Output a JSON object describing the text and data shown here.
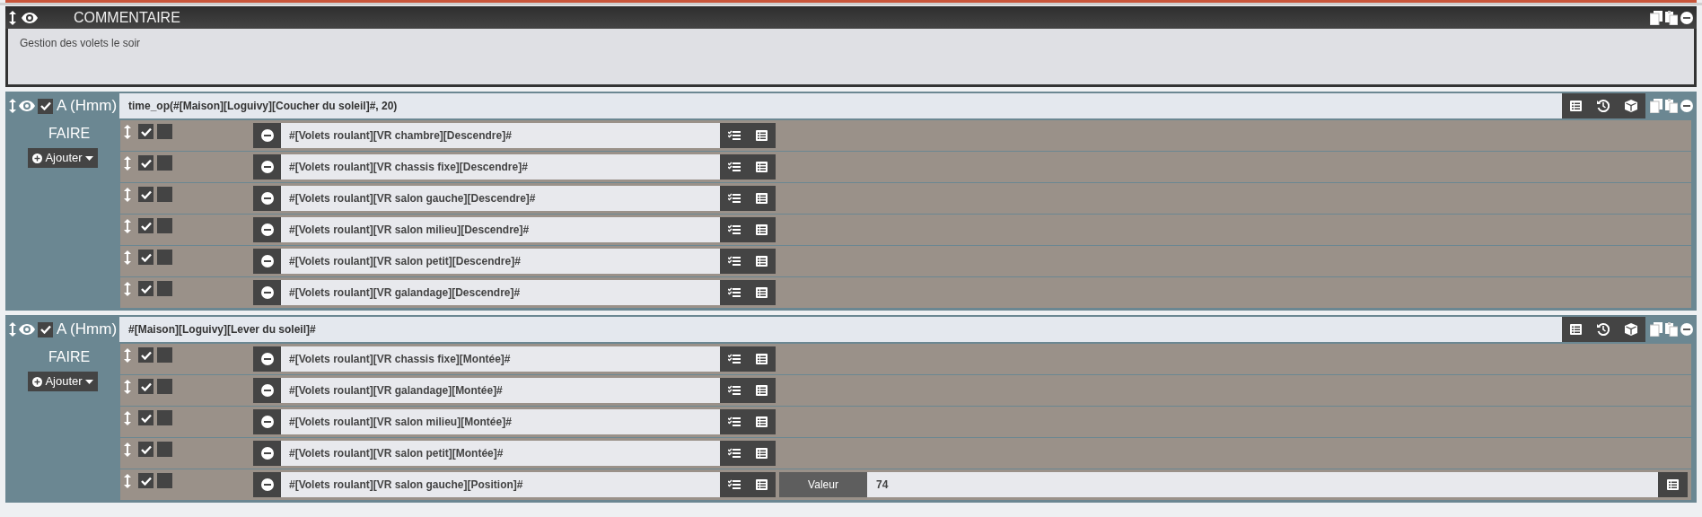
{
  "comment": {
    "title": "COMMENTAIRE",
    "text": "Gestion des volets le soir"
  },
  "blocks": [
    {
      "label": "A (Hmm)",
      "checked": true,
      "expression": "time_op(#[Maison][Loguivy][Coucher du soleil]#, 20)",
      "faire": "FAIRE",
      "add_button": "Ajouter",
      "actions": [
        {
          "checked": true,
          "flag": false,
          "command": "#[Volets roulant][VR chambre][Descendre]#"
        },
        {
          "checked": true,
          "flag": false,
          "command": "#[Volets roulant][VR chassis fixe][Descendre]#"
        },
        {
          "checked": true,
          "flag": false,
          "command": "#[Volets roulant][VR salon gauche][Descendre]#"
        },
        {
          "checked": true,
          "flag": false,
          "command": "#[Volets roulant][VR salon milieu][Descendre]#"
        },
        {
          "checked": true,
          "flag": false,
          "command": "#[Volets roulant][VR salon petit][Descendre]#"
        },
        {
          "checked": true,
          "flag": false,
          "command": "#[Volets roulant][VR galandage][Descendre]#"
        }
      ]
    },
    {
      "label": "A (Hmm)",
      "checked": true,
      "expression": "#[Maison][Loguivy][Lever du soleil]#",
      "faire": "FAIRE",
      "add_button": "Ajouter",
      "actions": [
        {
          "checked": true,
          "flag": false,
          "command": "#[Volets roulant][VR chassis fixe][Montée]#"
        },
        {
          "checked": true,
          "flag": false,
          "command": "#[Volets roulant][VR galandage][Montée]#"
        },
        {
          "checked": true,
          "flag": false,
          "command": "#[Volets roulant][VR salon milieu][Montée]#"
        },
        {
          "checked": true,
          "flag": false,
          "command": "#[Volets roulant][VR salon petit][Montée]#"
        },
        {
          "checked": true,
          "flag": false,
          "command": "#[Volets roulant][VR salon gauche][Position]#",
          "option": {
            "label": "Valeur",
            "value": "74"
          }
        }
      ]
    }
  ]
}
